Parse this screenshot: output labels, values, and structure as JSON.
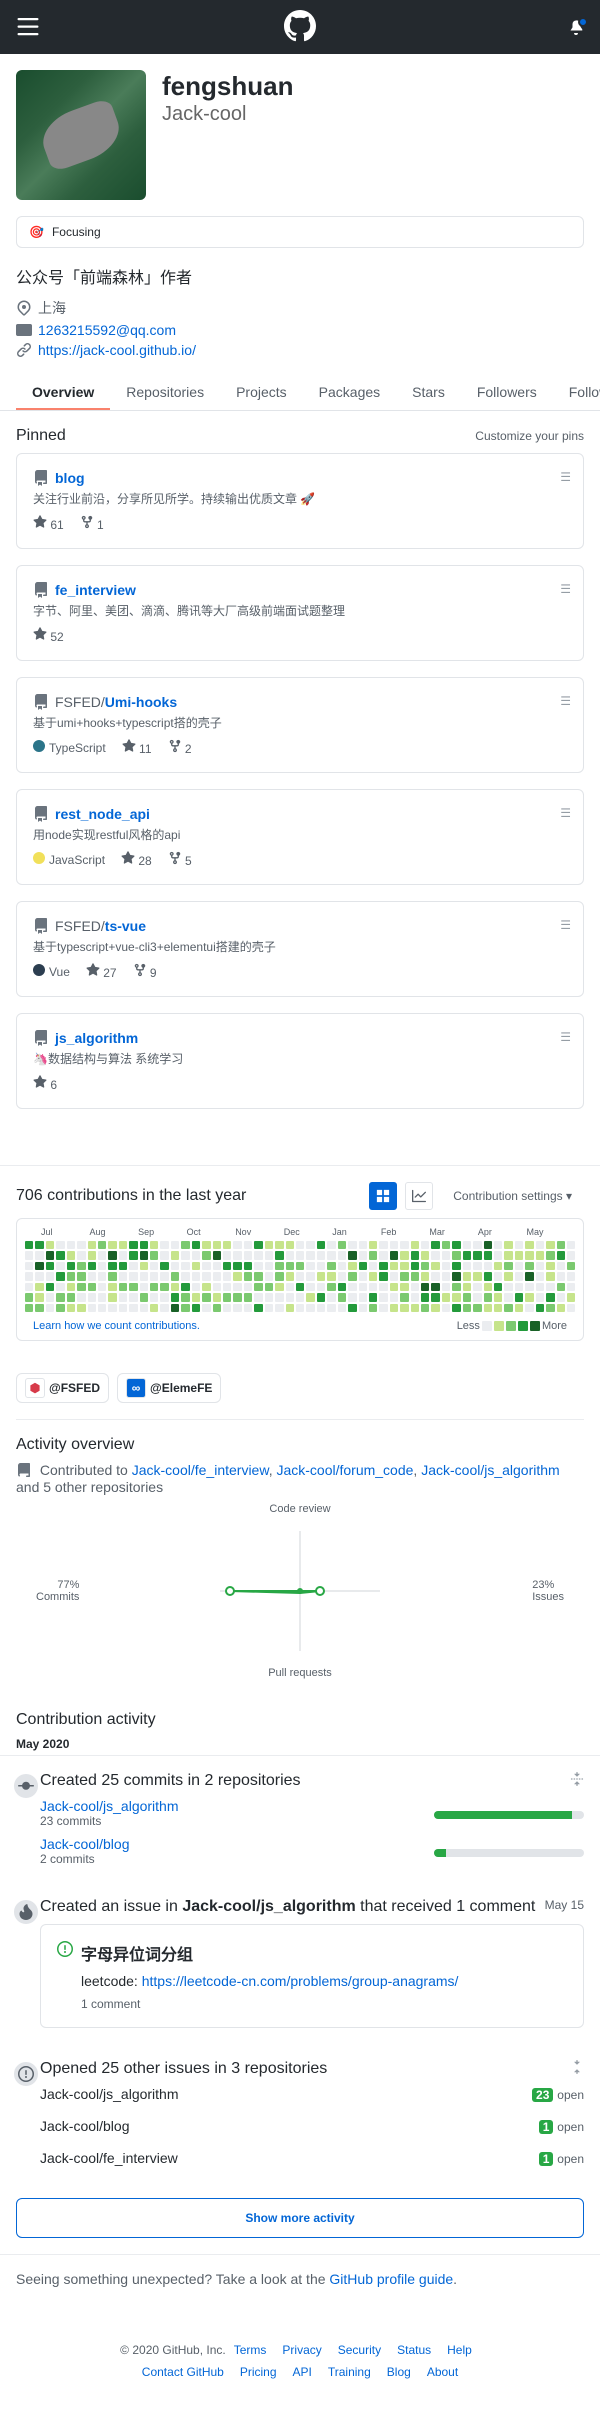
{
  "header": {
    "title": "GitHub"
  },
  "profile": {
    "name": "fengshuan",
    "username": "Jack-cool",
    "status_emoji": "🎯",
    "status_text": "Focusing",
    "bio": "公众号「前端森林」作者",
    "location": "上海",
    "email": "1263215592@qq.com",
    "website": "https://jack-cool.github.io/"
  },
  "tabs": [
    "Overview",
    "Repositories",
    "Projects",
    "Packages",
    "Stars",
    "Followers",
    "Following"
  ],
  "pinned": {
    "title": "Pinned",
    "customize": "Customize your pins",
    "items": [
      {
        "name": "blog",
        "owner": "",
        "desc_pre": "关注行业前沿，分享所见所学。持续输出优质文章 ",
        "desc_emoji": "🚀",
        "stars": "61",
        "forks": "1"
      },
      {
        "name": "fe_interview",
        "owner": "",
        "desc": "字节、阿里、美团、滴滴、腾讯等大厂高级前端面试题整理",
        "stars": "52"
      },
      {
        "name": "Umi-hooks",
        "owner": "FSFED/",
        "desc": "基于umi+hooks+typescript搭的壳子",
        "lang": "TypeScript",
        "lang_color": "#2b7489",
        "stars": "11",
        "forks": "2"
      },
      {
        "name": "rest_node_api",
        "owner": "",
        "desc": "用node实现restful风格的api",
        "lang": "JavaScript",
        "lang_color": "#f1e05a",
        "stars": "28",
        "forks": "5"
      },
      {
        "name": "ts-vue",
        "owner": "FSFED/",
        "desc": "基于typescript+vue-cli3+elementui搭建的壳子",
        "lang": "Vue",
        "lang_color": "#2c3e50",
        "stars": "27",
        "forks": "9"
      },
      {
        "name": "js_algorithm",
        "owner": "",
        "desc_pre": "",
        "desc_emoji": "🦄",
        "desc_post": "数据结构与算法 系统学习",
        "stars": "6"
      }
    ]
  },
  "contributions": {
    "title": "706 contributions in the last year",
    "settings": "Contribution settings",
    "months": [
      "Jul",
      "Aug",
      "Sep",
      "Oct",
      "Nov",
      "Dec",
      "Jan",
      "Feb",
      "Mar",
      "Apr",
      "May"
    ],
    "learn": "Learn how we count contributions.",
    "less": "Less",
    "more": "More"
  },
  "orgs": [
    {
      "name": "@FSFED",
      "icon_bg": "#fff",
      "icon_fg": "#d73a49",
      "icon_text": "⬢"
    },
    {
      "name": "@ElemeFE",
      "icon_bg": "#0366d6",
      "icon_fg": "#fff",
      "icon_text": "∞"
    }
  ],
  "activity_overview": {
    "title": "Activity overview",
    "contributed_pre": "Contributed to ",
    "repos": [
      "Jack-cool/fe_interview",
      "Jack-cool/forum_code",
      "Jack-cool/js_algorithm"
    ],
    "suffix": " and 5 other repositories",
    "radar": {
      "top": "Code review",
      "right": "Issues",
      "right_pct": "23%",
      "bottom": "Pull requests",
      "left": "Commits",
      "left_pct": "77%"
    }
  },
  "contribution_activity": {
    "title": "Contribution activity",
    "month": "May 2020",
    "commits": {
      "title": "Created 25 commits in 2 repositories",
      "items": [
        {
          "repo": "Jack-cool/js_algorithm",
          "count": "23 commits",
          "pct": 92
        },
        {
          "repo": "Jack-cool/blog",
          "count": "2 commits",
          "pct": 8
        }
      ]
    },
    "issue": {
      "title_pre": "Created an issue in ",
      "title_repo": "Jack-cool/js_algorithm",
      "title_post": " that received 1 comment",
      "date": "May 15",
      "issue_title": "字母异位词分组",
      "body_pre": "leetcode: ",
      "body_link": "https://leetcode-cn.com/problems/group-anagrams/",
      "comments": "1 comment"
    },
    "other_issues": {
      "title": "Opened 25 other issues in 3 repositories",
      "items": [
        {
          "repo": "Jack-cool/js_algorithm",
          "count": "23",
          "state": "open"
        },
        {
          "repo": "Jack-cool/blog",
          "count": "1",
          "state": "open"
        },
        {
          "repo": "Jack-cool/fe_interview",
          "count": "1",
          "state": "open"
        }
      ]
    },
    "show_more": "Show more activity"
  },
  "unexpected": {
    "pre": "Seeing something unexpected? Take a look at the ",
    "link": "GitHub profile guide",
    "post": "."
  },
  "footer": {
    "copyright": "© 2020 GitHub, Inc.",
    "links1": [
      "Terms",
      "Privacy",
      "Security",
      "Status",
      "Help"
    ],
    "links2": [
      "Contact GitHub",
      "Pricing",
      "API",
      "Training",
      "Blog",
      "About"
    ]
  }
}
